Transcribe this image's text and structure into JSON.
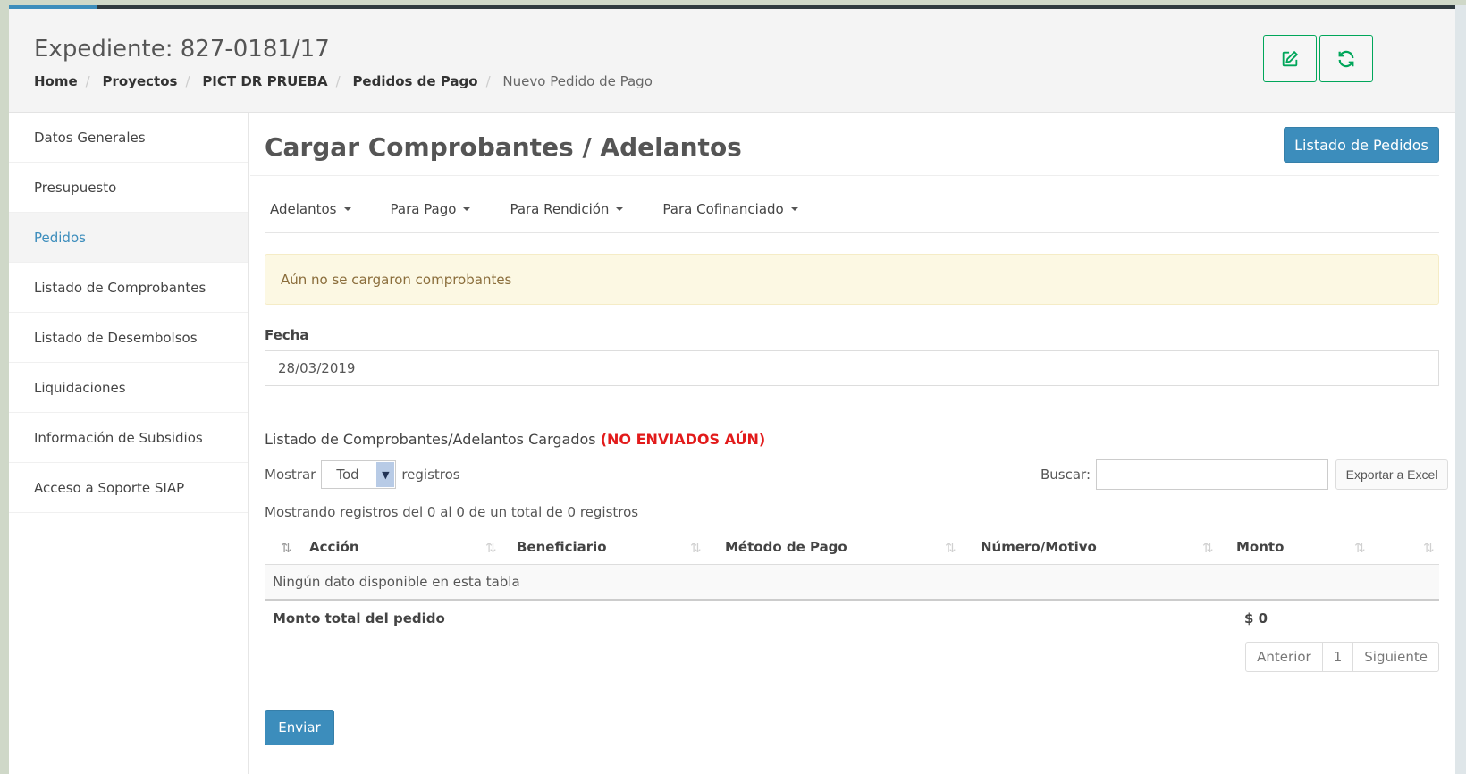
{
  "header": {
    "title": "Expediente: 827-0181/17",
    "breadcrumb": [
      "Home",
      "Proyectos",
      "PICT DR PRUEBA",
      "Pedidos de Pago"
    ],
    "breadcrumb_current": "Nuevo Pedido de Pago",
    "edit_icon": "edit-icon",
    "refresh_icon": "refresh-icon",
    "accent_color": "#00a65a"
  },
  "sidebar": {
    "items": [
      {
        "label": "Datos Generales"
      },
      {
        "label": "Presupuesto"
      },
      {
        "label": "Pedidos"
      },
      {
        "label": "Listado de Comprobantes"
      },
      {
        "label": "Listado de Desembolsos"
      },
      {
        "label": "Liquidaciones"
      },
      {
        "label": "Información de Subsidios"
      },
      {
        "label": "Acceso a Soporte SIAP"
      }
    ],
    "active": "Pedidos"
  },
  "main": {
    "title": "Cargar Comprobantes / Adelantos",
    "listado_button": "Listado de Pedidos",
    "tabs": [
      {
        "label": "Adelantos"
      },
      {
        "label": "Para Pago"
      },
      {
        "label": "Para Rendición"
      },
      {
        "label": "Para Cofinanciado"
      }
    ],
    "alert": "Aún no se cargaron comprobantes",
    "fecha_label": "Fecha",
    "fecha_value": "28/03/2019",
    "list_title": "Listado de Comprobantes/Adelantos Cargados",
    "list_title_warning": "(NO ENVIADOS AÚN)",
    "mostrar_label": "Mostrar",
    "mostrar_value": "Tod",
    "registros_label": "registros",
    "buscar_label": "Buscar:",
    "exportar_label": "Exportar a Excel",
    "info": "Mostrando registros del 0 al 0 de un total de 0 registros",
    "table": {
      "columns": [
        "Acción",
        "Beneficiario",
        "Método de Pago",
        "Número/Motivo",
        "Monto"
      ],
      "empty_message": "Ningún dato disponible en esta tabla",
      "total_label": "Monto total del pedido",
      "total_value": "$ 0"
    },
    "pagination": {
      "prev": "Anterior",
      "page": "1",
      "next": "Siguiente"
    },
    "enviar_label": "Enviar",
    "primary_color": "#3c8dbc",
    "warning_color": "#e21b1b"
  }
}
